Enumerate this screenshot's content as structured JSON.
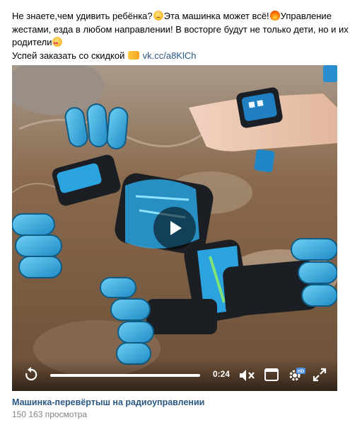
{
  "post": {
    "line1": "Не знаете,чем удивить ребёнка?",
    "line1b": "Эта машинка может всё!",
    "line1c": "Управление",
    "line2": "жестами, езда в любом направлении! В восторге будут не только дети, но и их",
    "line3": "родители",
    "line4": "Успей заказать со скидкой",
    "link": "vk.cc/a8KlCh",
    "emoji": [
      "thinking-face-emoji",
      "fire-emoji",
      "heart-eyes-emoji",
      "pointing-hand-emoji"
    ]
  },
  "video": {
    "current_time": "0:24",
    "progress": 1.0,
    "hd_badge": "HD",
    "title": "Машинка-перевёртыш на радиоуправлении",
    "views": "150 163 просмотра"
  },
  "colors": {
    "link": "#2a5885",
    "meta": "#828282",
    "toy_blue": "#2aa3df"
  }
}
